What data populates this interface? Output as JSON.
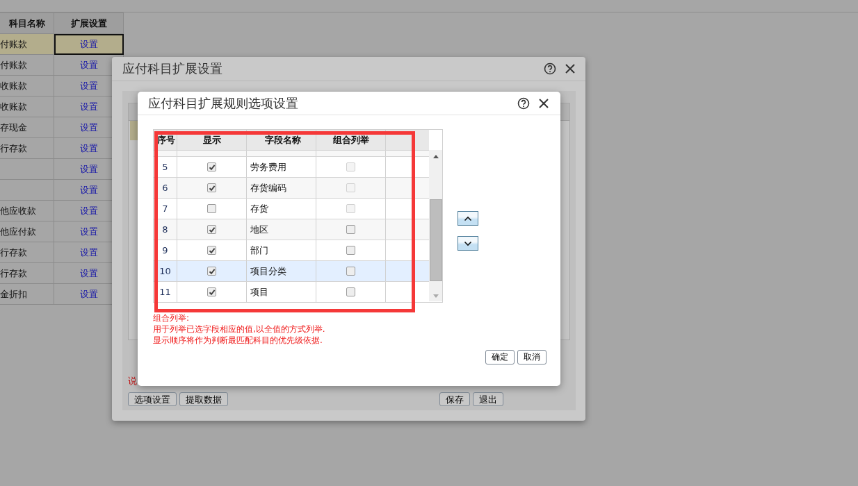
{
  "subjects_table": {
    "columns": [
      "科目名称",
      "扩展设置"
    ],
    "rows": [
      {
        "name": "付账款",
        "action": "设置",
        "selected": true
      },
      {
        "name": "付账款",
        "action": "设置",
        "selected": false
      },
      {
        "name": "收账款",
        "action": "设置",
        "selected": false
      },
      {
        "name": "收账款",
        "action": "设置",
        "selected": false
      },
      {
        "name": "存现金",
        "action": "设置",
        "selected": false
      },
      {
        "name": "行存款",
        "action": "设置",
        "selected": false
      },
      {
        "action": "设置",
        "selected": false
      },
      {
        "action": "设置",
        "selected": false
      },
      {
        "name": "他应收款",
        "action": "设置",
        "selected": false
      },
      {
        "name": "他应付款",
        "action": "设置",
        "selected": false
      },
      {
        "name": "行存款",
        "action": "设置",
        "selected": false
      },
      {
        "name": "行存款",
        "action": "设置",
        "selected": false
      },
      {
        "name": "金折扣",
        "action": "设置",
        "selected": false
      }
    ]
  },
  "outer_dialog": {
    "title": "应付科目扩展设置",
    "note": "说",
    "buttons_left": [
      "选项设置",
      "提取数据"
    ],
    "buttons_right": [
      "保存",
      "退出"
    ]
  },
  "rule_dialog": {
    "title": "应付科目扩展规则选项设置",
    "columns": [
      "序号",
      "显示",
      "字段名称",
      "组合列举"
    ],
    "rows": [
      {
        "number": "5",
        "show": true,
        "field": "劳务费用",
        "combo": false,
        "combo_disabled": true,
        "selected": false
      },
      {
        "number": "6",
        "show": true,
        "field": "存货编码",
        "combo": false,
        "combo_disabled": true,
        "selected": false
      },
      {
        "number": "7",
        "show": false,
        "field": "存货",
        "combo": false,
        "combo_disabled": true,
        "selected": false
      },
      {
        "number": "8",
        "show": true,
        "field": "地区",
        "combo": false,
        "combo_disabled": false,
        "selected": false
      },
      {
        "number": "9",
        "show": true,
        "field": "部门",
        "combo": false,
        "combo_disabled": false,
        "selected": false
      },
      {
        "number": "10",
        "show": true,
        "field": "项目分类",
        "combo": false,
        "combo_disabled": false,
        "selected": true
      },
      {
        "number": "11",
        "show": true,
        "field": "项目",
        "combo": false,
        "combo_disabled": false,
        "selected": false
      }
    ],
    "notes": [
      "组合列举:",
      "用于列举已选字段相应的值,以全值的方式列举.",
      "显示顺序将作为判断最匹配科目的优先级依据."
    ],
    "buttons": [
      "确定",
      "取消"
    ]
  }
}
